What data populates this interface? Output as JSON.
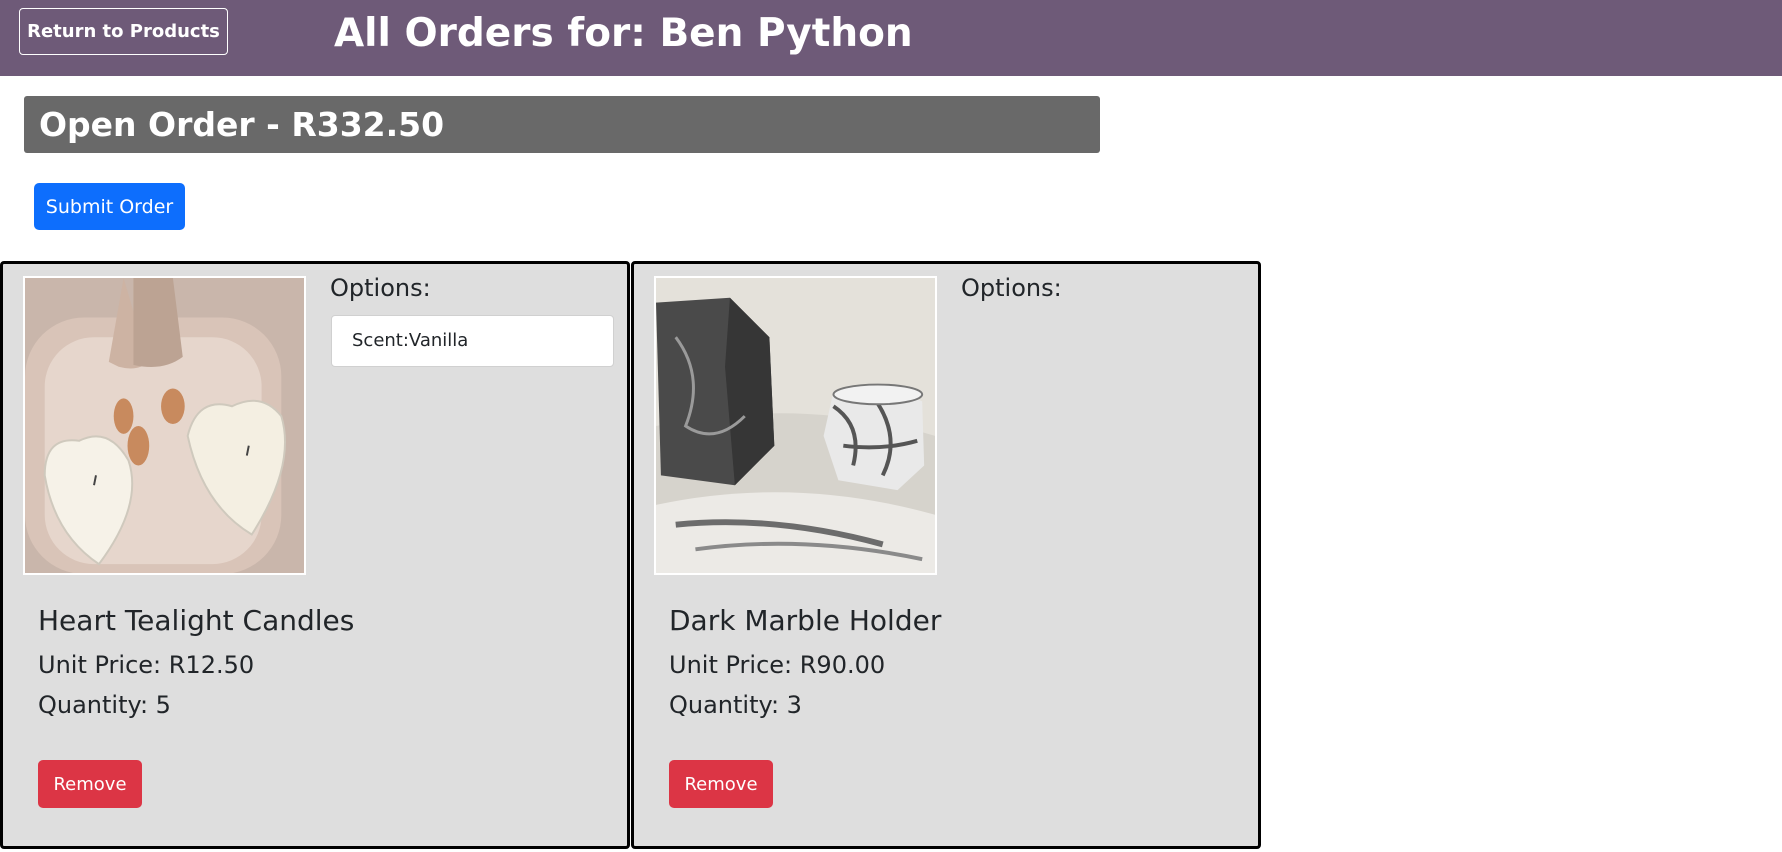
{
  "header": {
    "return_label": "Return to Products",
    "title": "All Orders for: Ben Python"
  },
  "order": {
    "title": "Open Order - R332.50",
    "submit_label": "Submit Order"
  },
  "items": [
    {
      "options_label": "Options:",
      "options": [
        "Scent:Vanilla"
      ],
      "name": "Heart Tealight Candles",
      "unit_price": "Unit Price: R12.50",
      "quantity": "Quantity: 5",
      "remove_label": "Remove"
    },
    {
      "options_label": "Options:",
      "options": [],
      "name": "Dark Marble Holder",
      "unit_price": "Unit Price: R90.00",
      "quantity": "Quantity: 3",
      "remove_label": "Remove"
    }
  ],
  "colors": {
    "topbar": "#6e5a78",
    "order_header": "#696969",
    "submit": "#0d6efd",
    "remove": "#dc3545",
    "card_bg": "#dedede"
  }
}
